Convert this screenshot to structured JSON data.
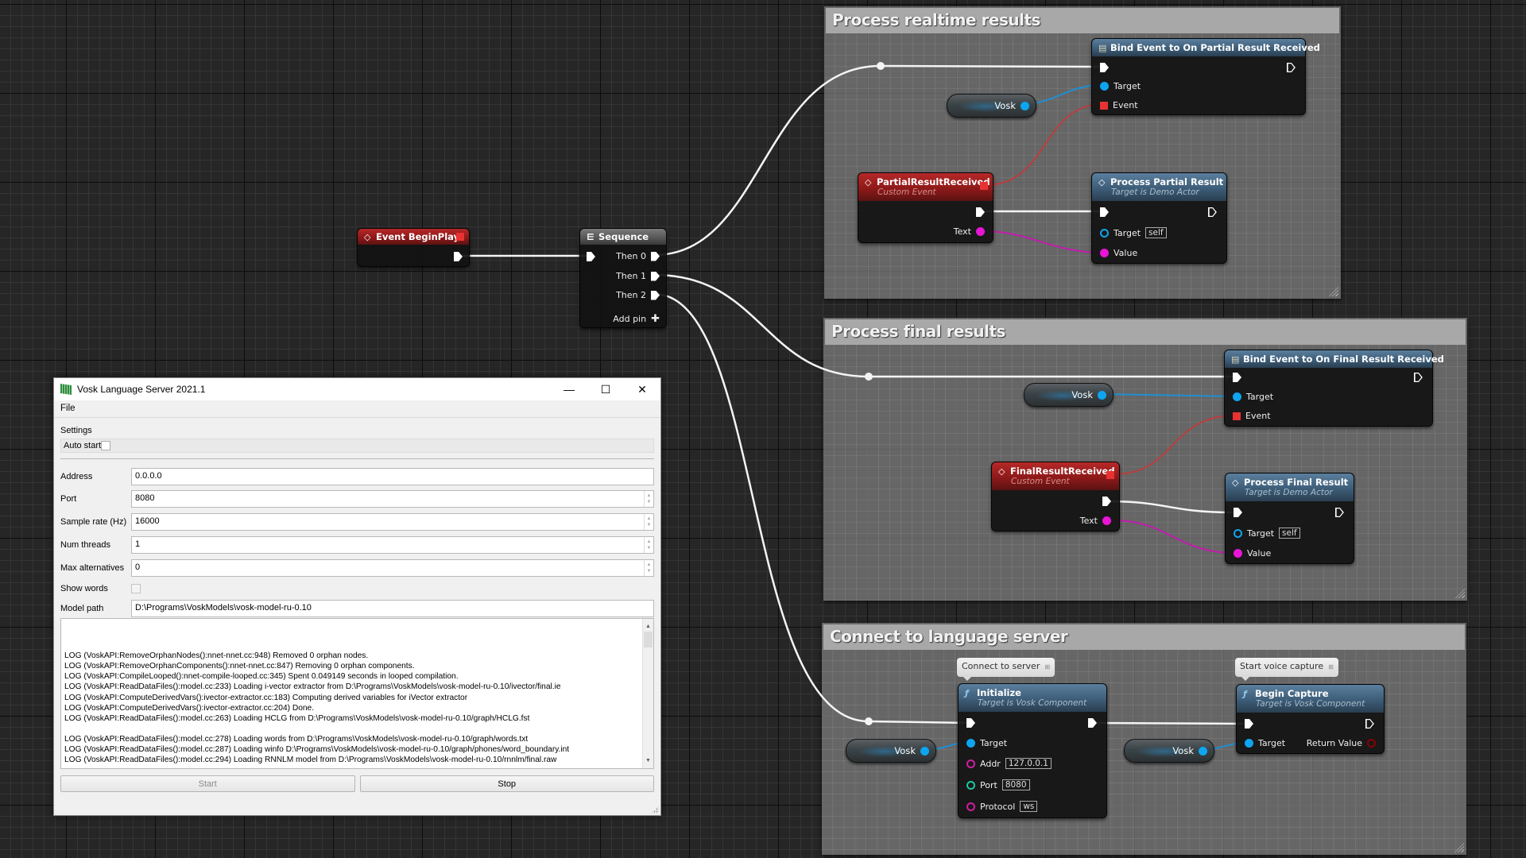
{
  "graph": {
    "comments": [
      {
        "id": "realtime",
        "title": "Process realtime results"
      },
      {
        "id": "final",
        "title": "Process final results"
      },
      {
        "id": "connect",
        "title": "Connect to language server"
      }
    ],
    "event_beginplay": {
      "title": "Event BeginPlay"
    },
    "sequence": {
      "title": "Sequence",
      "pins": [
        "Then 0",
        "Then 1",
        "Then 2"
      ],
      "add_pin": "Add pin"
    },
    "bind_partial": {
      "title": "Bind Event to On Partial Result Received",
      "pins": [
        "Target",
        "Event"
      ]
    },
    "bind_final": {
      "title": "Bind Event to On Final Result Received",
      "pins": [
        "Target",
        "Event"
      ]
    },
    "partial_event": {
      "title": "PartialResultReceived",
      "subtitle": "Custom Event",
      "pin": "Text"
    },
    "final_event": {
      "title": "FinalResultReceived",
      "subtitle": "Custom Event",
      "pin": "Text"
    },
    "process_partial": {
      "title": "Process Partial Result",
      "subtitle": "Target is Demo Actor",
      "target_label": "Target",
      "target_default": "self",
      "value_label": "Value"
    },
    "process_final": {
      "title": "Process Final Result",
      "subtitle": "Target is Demo Actor",
      "target_label": "Target",
      "target_default": "self",
      "value_label": "Value"
    },
    "initialize": {
      "title": "Initialize",
      "subtitle": "Target is Vosk Component",
      "comment": "Connect to server",
      "target_label": "Target",
      "addr_label": "Addr",
      "addr_value": "127.0.0.1",
      "port_label": "Port",
      "port_value": "8080",
      "protocol_label": "Protocol",
      "protocol_value": "ws"
    },
    "begin_capture": {
      "title": "Begin Capture",
      "subtitle": "Target is Vosk Component",
      "comment": "Start voice capture",
      "target_label": "Target",
      "return_label": "Return Value"
    },
    "vosk_var": "Vosk",
    "colors": {
      "exec": "#ffffff",
      "object": "#0ea5f0",
      "delegate": "#e83232",
      "text": "#e815d6",
      "int": "#1fc7a0",
      "string": "#d01ea0",
      "bool_return": "#8a0000"
    }
  },
  "window": {
    "title": "Vosk Language Server 2021.1",
    "controls": {
      "minimize": "—",
      "maximize": "☐",
      "close": "✕"
    },
    "menu": [
      "File"
    ],
    "settings_label": "Settings",
    "auto_start_label": "Auto start",
    "auto_start_checked": false,
    "fields": [
      {
        "label": "Address",
        "value": "0.0.0.0",
        "spin": false
      },
      {
        "label": "Port",
        "value": "8080",
        "spin": true
      },
      {
        "label": "Sample rate (Hz)",
        "value": "16000",
        "spin": true
      },
      {
        "label": "Num threads",
        "value": "1",
        "spin": true
      },
      {
        "label": "Max alternatives",
        "value": "0",
        "spin": true
      }
    ],
    "show_words_label": "Show words",
    "show_words_checked": false,
    "model_path_label": "Model path",
    "model_path_value": "D:\\Programs\\VoskModels\\vosk-model-ru-0.10",
    "log_lines": [
      "LOG (VoskAPI:RemoveOrphanNodes():nnet-nnet.cc:948) Removed 0 orphan nodes.",
      "LOG (VoskAPI:RemoveOrphanComponents():nnet-nnet.cc:847) Removing 0 orphan components.",
      "LOG (VoskAPI:CompileLooped():nnet-compile-looped.cc:345) Spent 0.049149 seconds in looped compilation.",
      "LOG (VoskAPI:ReadDataFiles():model.cc:233) Loading i-vector extractor from D:\\Programs\\VoskModels\\vosk-model-ru-0.10/ivector/final.ie",
      "LOG (VoskAPI:ComputeDerivedVars():ivector-extractor.cc:183) Computing derived variables for iVector extractor",
      "LOG (VoskAPI:ComputeDerivedVars():ivector-extractor.cc:204) Done.",
      "LOG (VoskAPI:ReadDataFiles():model.cc:263) Loading HCLG from D:\\Programs\\VoskModels\\vosk-model-ru-0.10/graph/HCLG.fst",
      "",
      "LOG (VoskAPI:ReadDataFiles():model.cc:278) Loading words from D:\\Programs\\VoskModels\\vosk-model-ru-0.10/graph/words.txt",
      "LOG (VoskAPI:ReadDataFiles():model.cc:287) Loading winfo D:\\Programs\\VoskModels\\vosk-model-ru-0.10/graph/phones/word_boundary.int",
      "LOG (VoskAPI:ReadDataFiles():model.cc:294) Loading RNNLM model from D:\\Programs\\VoskModels\\vosk-model-ru-0.10/rnnlm/final.raw"
    ],
    "start_label": "Start",
    "start_enabled": false,
    "stop_label": "Stop"
  }
}
